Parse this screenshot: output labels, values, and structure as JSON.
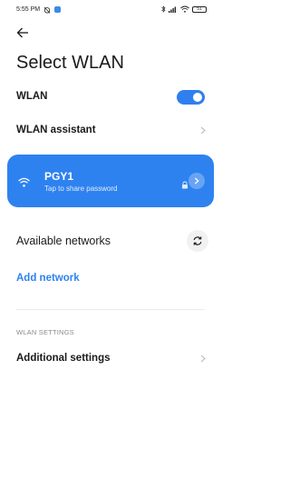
{
  "status_bar": {
    "time": "5:55 PM",
    "battery": "51"
  },
  "header": {
    "back_icon": "arrow-left-icon",
    "title": "Select WLAN"
  },
  "wlan_toggle": {
    "label": "WLAN",
    "state": "on"
  },
  "wlan_assistant": {
    "label": "WLAN assistant"
  },
  "connected_network": {
    "ssid": "PGY1",
    "subtitle": "Tap to share password",
    "secured": true
  },
  "available": {
    "title": "Available networks",
    "add_network": "Add network"
  },
  "settings_section": {
    "header": "WLAN SETTINGS",
    "additional_settings": "Additional settings"
  },
  "colors": {
    "accent": "#2e82f0",
    "toggle_on": "#2f7ff0",
    "text": "#1a1a1a",
    "muted": "#8a8a8a"
  }
}
